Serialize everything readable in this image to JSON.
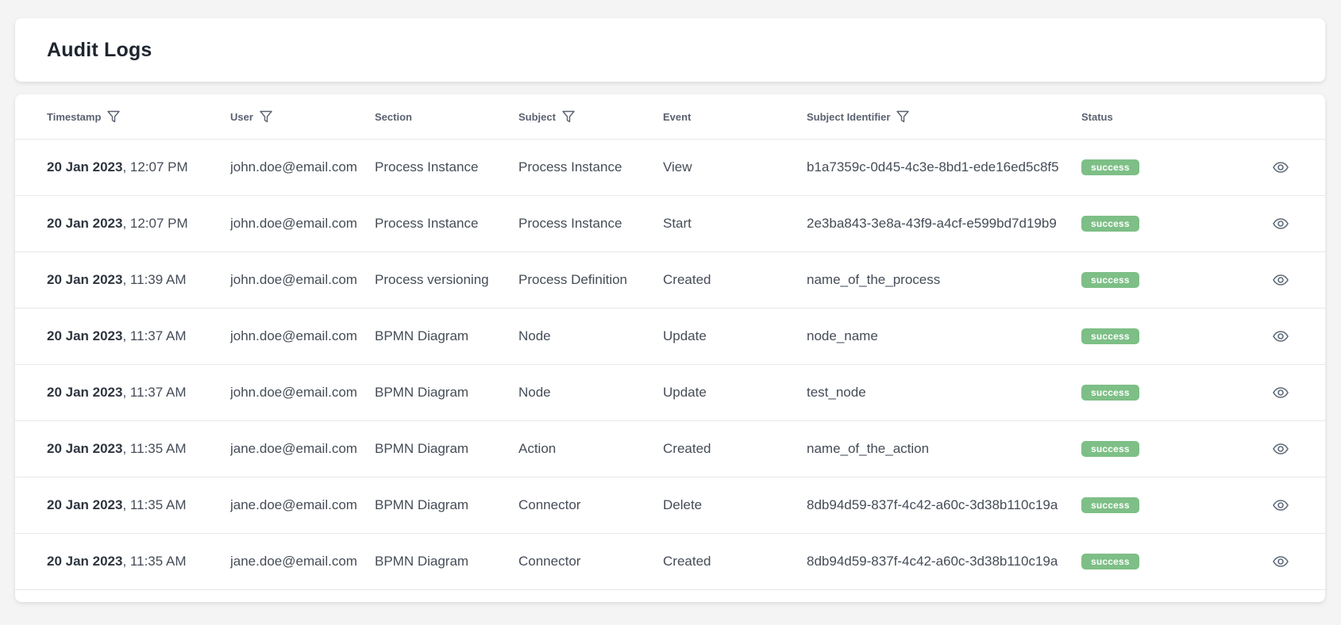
{
  "page": {
    "title": "Audit Logs"
  },
  "table": {
    "headers": {
      "timestamp": "Timestamp",
      "user": "User",
      "section": "Section",
      "subject": "Subject",
      "event": "Event",
      "subject_identifier": "Subject Identifier",
      "status": "Status"
    },
    "rows": [
      {
        "date": "20 Jan 2023",
        "time": ", 12:07 PM",
        "user": "john.doe@email.com",
        "section": "Process Instance",
        "subject": "Process Instance",
        "event": "View",
        "subject_identifier": "b1a7359c-0d45-4c3e-8bd1-ede16ed5c8f5",
        "status": "success"
      },
      {
        "date": "20 Jan 2023",
        "time": ", 12:07 PM",
        "user": "john.doe@email.com",
        "section": "Process Instance",
        "subject": "Process Instance",
        "event": "Start",
        "subject_identifier": "2e3ba843-3e8a-43f9-a4cf-e599bd7d19b9",
        "status": "success"
      },
      {
        "date": "20 Jan 2023",
        "time": ", 11:39 AM",
        "user": "john.doe@email.com",
        "section": "Process versioning",
        "subject": "Process Definition",
        "event": "Created",
        "subject_identifier": "name_of_the_process",
        "status": "success"
      },
      {
        "date": "20 Jan 2023",
        "time": ", 11:37 AM",
        "user": "john.doe@email.com",
        "section": "BPMN Diagram",
        "subject": "Node",
        "event": "Update",
        "subject_identifier": "node_name",
        "status": "success"
      },
      {
        "date": "20 Jan 2023",
        "time": ", 11:37 AM",
        "user": "john.doe@email.com",
        "section": "BPMN Diagram",
        "subject": "Node",
        "event": "Update",
        "subject_identifier": "test_node",
        "status": "success"
      },
      {
        "date": "20 Jan 2023",
        "time": ", 11:35 AM",
        "user": "jane.doe@email.com",
        "section": "BPMN Diagram",
        "subject": "Action",
        "event": "Created",
        "subject_identifier": "name_of_the_action",
        "status": "success"
      },
      {
        "date": "20 Jan 2023",
        "time": ", 11:35 AM",
        "user": "jane.doe@email.com",
        "section": "BPMN Diagram",
        "subject": "Connector",
        "event": "Delete",
        "subject_identifier": "8db94d59-837f-4c42-a60c-3d38b110c19a",
        "status": "success"
      },
      {
        "date": "20 Jan 2023",
        "time": ", 11:35 AM",
        "user": "jane.doe@email.com",
        "section": "BPMN Diagram",
        "subject": "Connector",
        "event": "Created",
        "subject_identifier": "8db94d59-837f-4c42-a60c-3d38b110c19a",
        "status": "success"
      }
    ]
  },
  "icons": {
    "filter": "filter-icon",
    "view": "eye-icon"
  },
  "colors": {
    "success_badge": "#7dbf86",
    "background": "#f4f4f5",
    "card": "#ffffff"
  }
}
